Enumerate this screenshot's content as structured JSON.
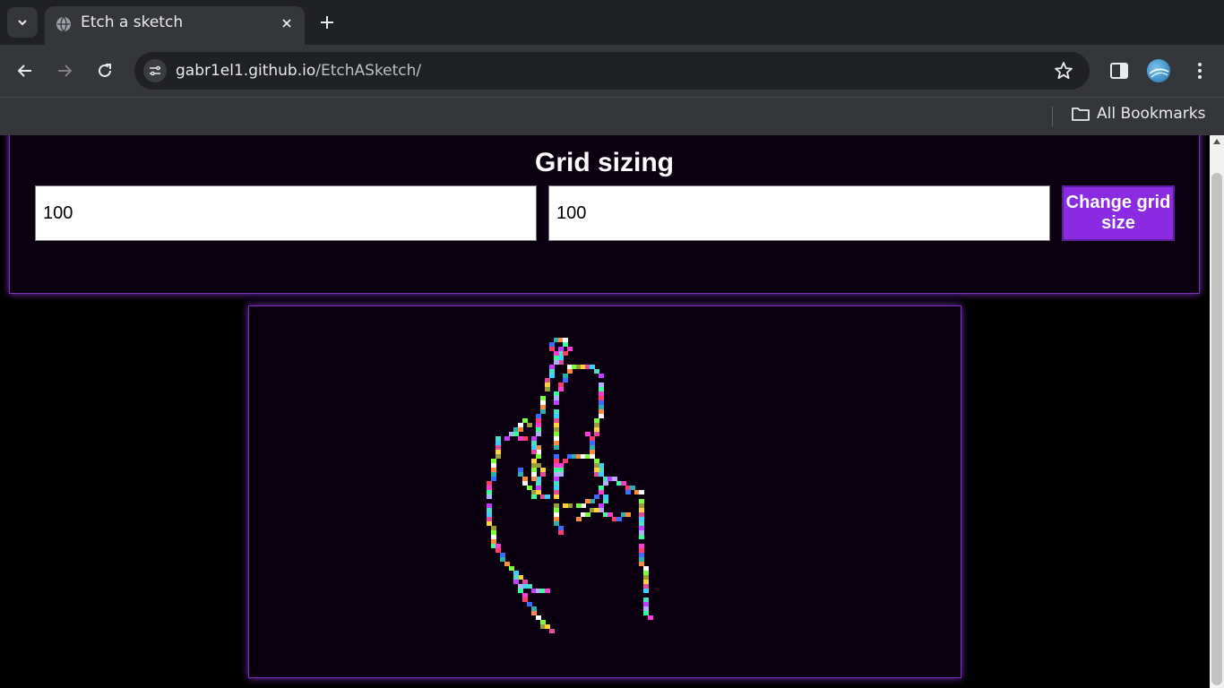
{
  "browser": {
    "tab_title": "Etch a sketch",
    "url_host": "gabr1el1.github.io",
    "url_path": "/EtchASketch/",
    "bookmarks_label": "All Bookmarks"
  },
  "page": {
    "panel_title": "Grid sizing",
    "width_value": "100",
    "height_value": "100",
    "change_button_label": "Change grid size"
  },
  "colors": {
    "accent": "#8a2be2",
    "panel_bg": "#0b0010",
    "page_bg": "#000000"
  }
}
